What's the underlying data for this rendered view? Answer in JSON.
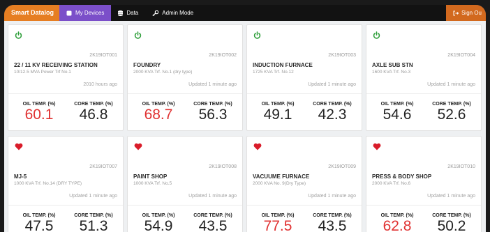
{
  "nav": {
    "brand": "Smart Datalog",
    "items": [
      {
        "label": "My Devices",
        "icon": "device-icon"
      },
      {
        "label": "Data",
        "icon": "database-icon"
      },
      {
        "label": "Admin Mode",
        "icon": "key-icon"
      }
    ],
    "signout": "Sign Ou",
    "colors": {
      "brand": "#e67e22",
      "active": "#7b4fc9",
      "signout": "#d2691e"
    }
  },
  "labels": {
    "oil": "OIL TEMP. (%)",
    "core": "CORE TEMP. (%)"
  },
  "colors": {
    "power_on": "#2e9e3a",
    "heart": "#d91c2a",
    "alert_value": "#e03131"
  },
  "devices": [
    {
      "status": "power",
      "code": "2K19IOT001",
      "name": "22 / 11 KV RECEIVING STATION",
      "desc": "10/12.5 MVA Power Trf No.1",
      "time": "2010 hours ago",
      "oil": "60.1",
      "oil_alert": true,
      "core": "46.8"
    },
    {
      "status": "power",
      "code": "2K19IOT002",
      "name": "FOUNDRY",
      "desc": "2000 KVA Trf. No.1 (dry type)",
      "time": "Updated 1 minute ago",
      "oil": "68.7",
      "oil_alert": true,
      "core": "56.3"
    },
    {
      "status": "power",
      "code": "2K19IOT003",
      "name": "INDUCTION FURNACE",
      "desc": "1725 KVA Trf. No.12",
      "time": "Updated 1 minute ago",
      "oil": "49.1",
      "oil_alert": false,
      "core": "42.3"
    },
    {
      "status": "power",
      "code": "2K19IOT004",
      "name": "AXLE SUB STN",
      "desc": "1600 KVA Trf. No.3",
      "time": "Updated 1 minute ago",
      "oil": "54.6",
      "oil_alert": false,
      "core": "52.6"
    },
    {
      "status": "heart",
      "code": "2K19IOT007",
      "name": "MJ-5",
      "desc": "1000 KVA Trf. No.14 (DRY TYPE)",
      "time": "Updated 1 minute ago",
      "oil": "47.5",
      "oil_alert": false,
      "core": "51.3"
    },
    {
      "status": "heart",
      "code": "2K19IOT008",
      "name": "PAINT SHOP",
      "desc": "1000 KVA Trf. No.5",
      "time": "Updated 1 minute ago",
      "oil": "54.9",
      "oil_alert": false,
      "core": "43.5"
    },
    {
      "status": "heart",
      "code": "2K19IOT009",
      "name": "VACUUME FURNACE",
      "desc": "2000 KVA No. 9(Dry Type)",
      "time": "Updated 1 minute ago",
      "oil": "77.5",
      "oil_alert": true,
      "core": "43.5"
    },
    {
      "status": "heart",
      "code": "2K19IOT010",
      "name": "PRESS & BODY SHOP",
      "desc": "2000 KVA Trf. No.6",
      "time": "Updated 1 minute ago",
      "oil": "62.8",
      "oil_alert": true,
      "core": "50.2"
    }
  ]
}
